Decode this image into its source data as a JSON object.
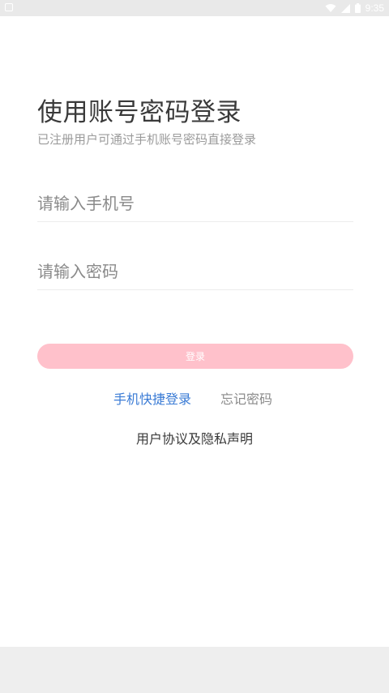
{
  "status_bar": {
    "time": "9:35",
    "icons": [
      "notification-icon",
      "wifi-icon",
      "signal-icon",
      "battery-icon"
    ]
  },
  "header": {
    "title": "使用账号密码登录",
    "subtitle": "已注册用户可通过手机账号密码直接登录"
  },
  "form": {
    "phone_placeholder": "请输入手机号",
    "password_placeholder": "请输入密码",
    "login_label": "登录"
  },
  "links": {
    "quick_login": "手机快捷登录",
    "forgot_password": "忘记密码",
    "agreement": "用户协议及隐私声明"
  },
  "colors": {
    "accent_pink": "#ffc1cb",
    "link_blue": "#3a7bd5",
    "status_bar": "#e9e9e9"
  }
}
